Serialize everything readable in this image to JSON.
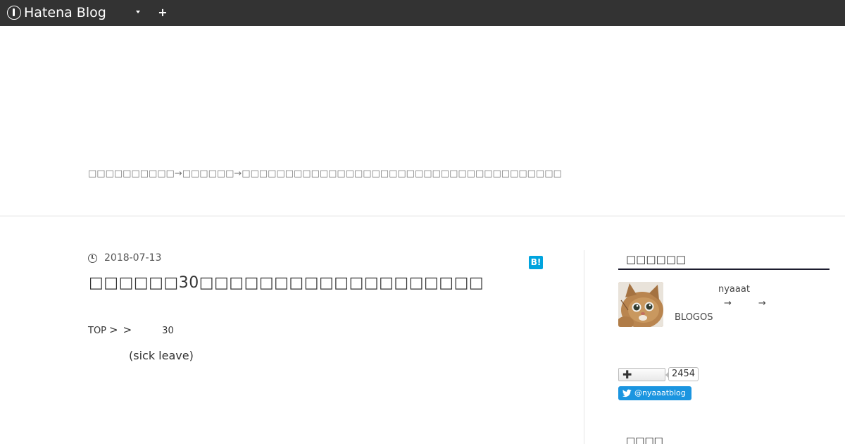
{
  "topbar": {
    "logo_text": "Hatena Blog",
    "icons": {
      "logo": "hatena-blog-logo-icon",
      "menu": "caret-down-icon",
      "add": "plus-icon"
    }
  },
  "header": {
    "description": "□□□□□□□□□□→□□□□□□→□□□□□□□□□□□□□□□□□□□□□□□□□□□□□□□□□□□□□"
  },
  "entry": {
    "date": "2018-07-13",
    "title": "□□□□□□30□□□□□□□□□□□□□□□□□□□",
    "breadcrumb": {
      "top": "TOP",
      "sep1": ">",
      "sep2": ">",
      "num": "30"
    },
    "body": "(sick leave)",
    "bookmark_label": "B!",
    "icons": {
      "date": "clock-icon",
      "bookmark": "hatena-bookmark-icon"
    }
  },
  "sidebar": {
    "heading": "□□□□□□",
    "profile": {
      "id": "nyaaat",
      "arrow1": "→",
      "arrow2": "→",
      "blogos": "BLOGOS"
    },
    "follow": {
      "plus": "✚",
      "count": "2454"
    },
    "twitter": {
      "label": "@nyaaatblog",
      "icon": "twitter-bird-icon"
    },
    "heading2": "□□□□"
  },
  "colors": {
    "topbar": "#333333",
    "bookmark": "#00a4de",
    "twitter": "#1b95e0",
    "heading_rule": "#1c1c2e"
  }
}
